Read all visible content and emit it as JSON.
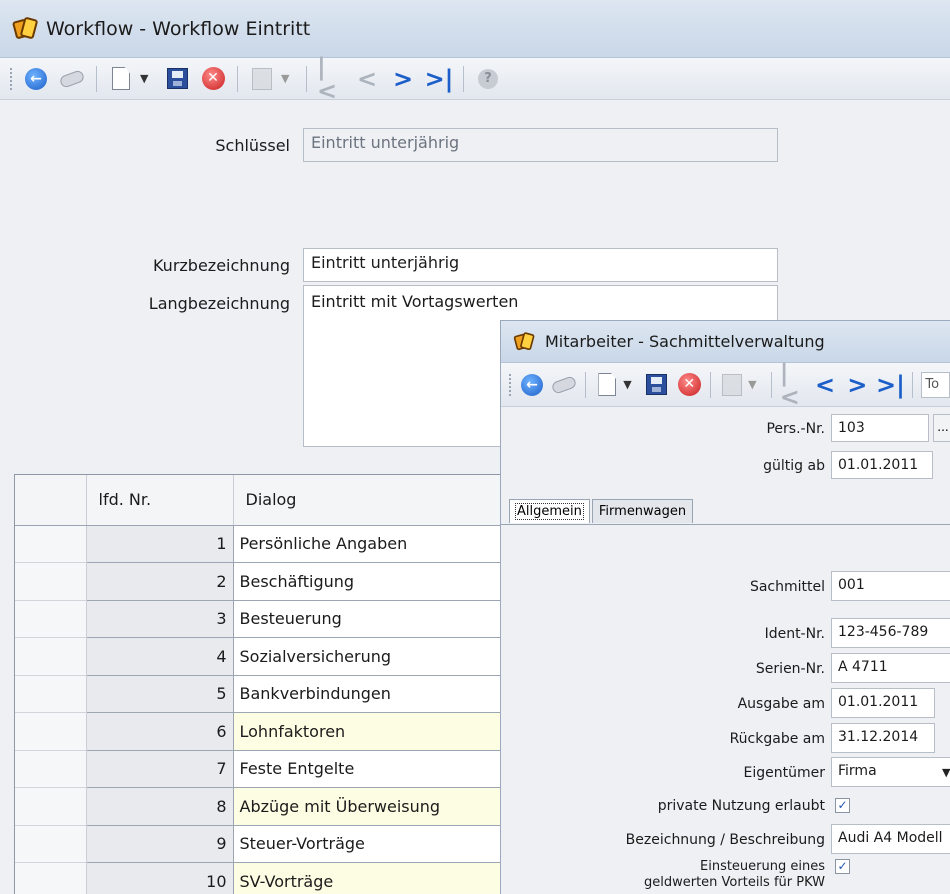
{
  "workflow": {
    "title": "Workflow - Workflow Eintritt",
    "schluessel_label": "Schlüssel",
    "schluessel_value": "Eintritt unterjährig",
    "kurz_label": "Kurzbezeichnung",
    "kurz_value": "Eintritt unterjährig",
    "lang_label": "Langbezeichnung",
    "lang_value": "Eintritt mit Vortagswerten",
    "grid": {
      "col_nr": "lfd. Nr.",
      "col_dialog": "Dialog",
      "rows": [
        {
          "nr": "1",
          "dialog": "Persönliche Angaben",
          "highlight": false
        },
        {
          "nr": "2",
          "dialog": "Beschäftigung",
          "highlight": false
        },
        {
          "nr": "3",
          "dialog": "Besteuerung",
          "highlight": false
        },
        {
          "nr": "4",
          "dialog": "Sozialversicherung",
          "highlight": false
        },
        {
          "nr": "5",
          "dialog": "Bankverbindungen",
          "highlight": false
        },
        {
          "nr": "6",
          "dialog": "Lohnfaktoren",
          "highlight": true
        },
        {
          "nr": "7",
          "dialog": "Feste Entgelte",
          "highlight": false
        },
        {
          "nr": "8",
          "dialog": "Abzüge mit Überweisung",
          "highlight": true
        },
        {
          "nr": "9",
          "dialog": "Steuer-Vorträge",
          "highlight": false
        },
        {
          "nr": "10",
          "dialog": "SV-Vorträge",
          "highlight": true
        }
      ]
    }
  },
  "sachmittel": {
    "title": "Mitarbeiter - Sachmittelverwaltung",
    "toolbar_text": "To",
    "persnr_label": "Pers.-Nr.",
    "persnr_value": "103",
    "lookup_button": "...",
    "gueltig_label": "gültig ab",
    "gueltig_value": "01.01.2011",
    "tabs": [
      "Allgemein",
      "Firmenwagen"
    ],
    "sachmittel_label": "Sachmittel",
    "sachmittel_value": "001",
    "ident_label": "Ident-Nr.",
    "ident_value": "123-456-789",
    "serien_label": "Serien-Nr.",
    "serien_value": "A 4711",
    "ausgabe_label": "Ausgabe am",
    "ausgabe_value": "01.01.2011",
    "rueckgabe_label": "Rückgabe am",
    "rueckgabe_value": "31.12.2014",
    "eigentuemer_label": "Eigentümer",
    "eigentuemer_value": "Firma",
    "private_label": "private Nutzung erlaubt",
    "private_checked": true,
    "bezeichnung_label": "Bezeichnung / Beschreibung",
    "bezeichnung_value": "Audi A4 Modell",
    "einsteuerung_label_1": "Einsteuerung eines",
    "einsteuerung_label_2": "geldwerten Vorteils für PKW",
    "einsteuerung_checked": true
  }
}
